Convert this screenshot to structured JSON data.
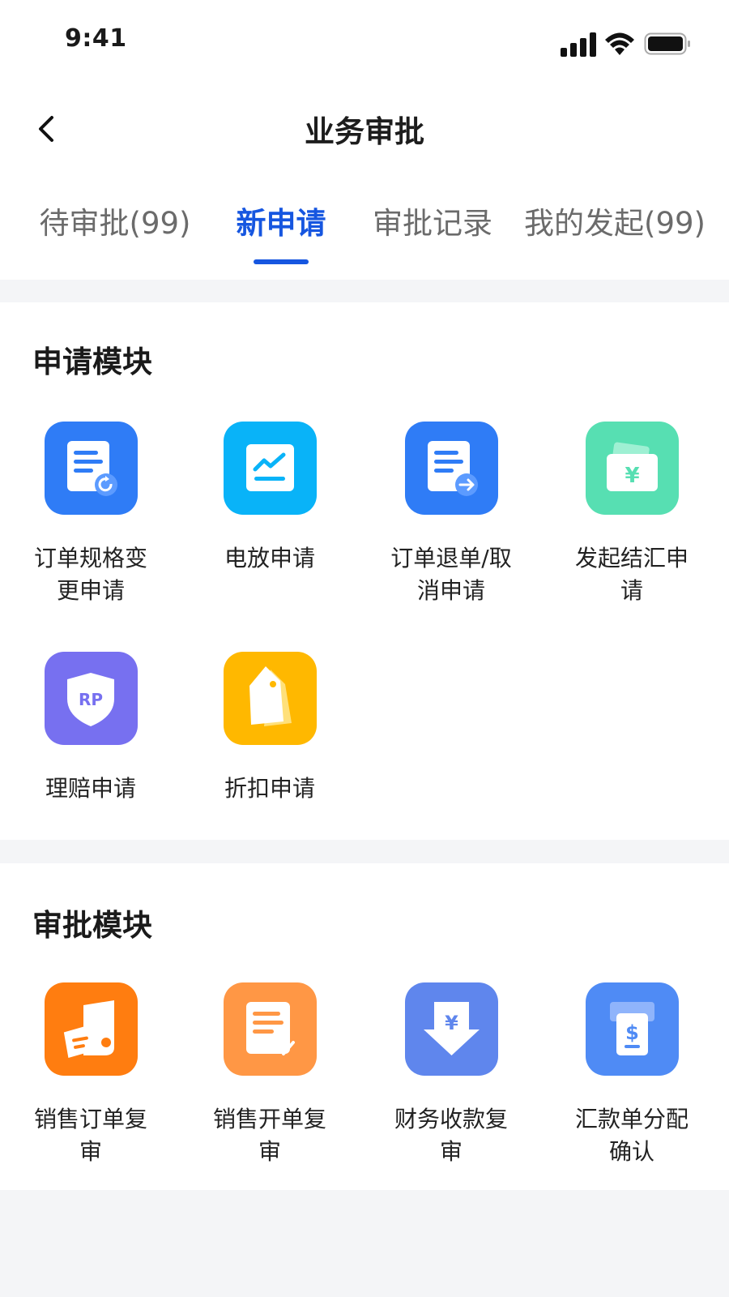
{
  "status_bar": {
    "time": "9:41"
  },
  "header": {
    "title": "业务审批"
  },
  "tabs": [
    {
      "label": "待审批(99)",
      "active": false
    },
    {
      "label": "新申请",
      "active": true
    },
    {
      "label": "审批记录",
      "active": false
    },
    {
      "label": "我的发起(99)",
      "active": false
    }
  ],
  "apply_module": {
    "title": "申请模块",
    "items": [
      {
        "label": "订单规格变更申请",
        "icon": "document-refresh-icon",
        "color": "#2f7cf6"
      },
      {
        "label": "电放申请",
        "icon": "chart-line-icon",
        "color": "#09b3f8"
      },
      {
        "label": "订单退单/取消申请",
        "icon": "document-arrow-icon",
        "color": "#2f7cf6"
      },
      {
        "label": "发起结汇申请",
        "icon": "wallet-yen-icon",
        "color": "#57dfb2"
      },
      {
        "label": "理赔申请",
        "icon": "shield-rp-icon",
        "color": "#7770f0"
      },
      {
        "label": "折扣申请",
        "icon": "price-tag-icon",
        "color": "#ffb800"
      }
    ]
  },
  "approve_module": {
    "title": "审批模块",
    "items": [
      {
        "label": "销售订单复审",
        "icon": "music-note-document-icon",
        "color": "#ff7d10"
      },
      {
        "label": "销售开单复审",
        "icon": "document-pen-icon",
        "color": "#ff9745"
      },
      {
        "label": "财务收款复审",
        "icon": "yen-download-icon",
        "color": "#5f86ed"
      },
      {
        "label": "汇款单分配确认",
        "icon": "dollar-receipt-icon",
        "color": "#4f8bf5"
      }
    ]
  }
}
